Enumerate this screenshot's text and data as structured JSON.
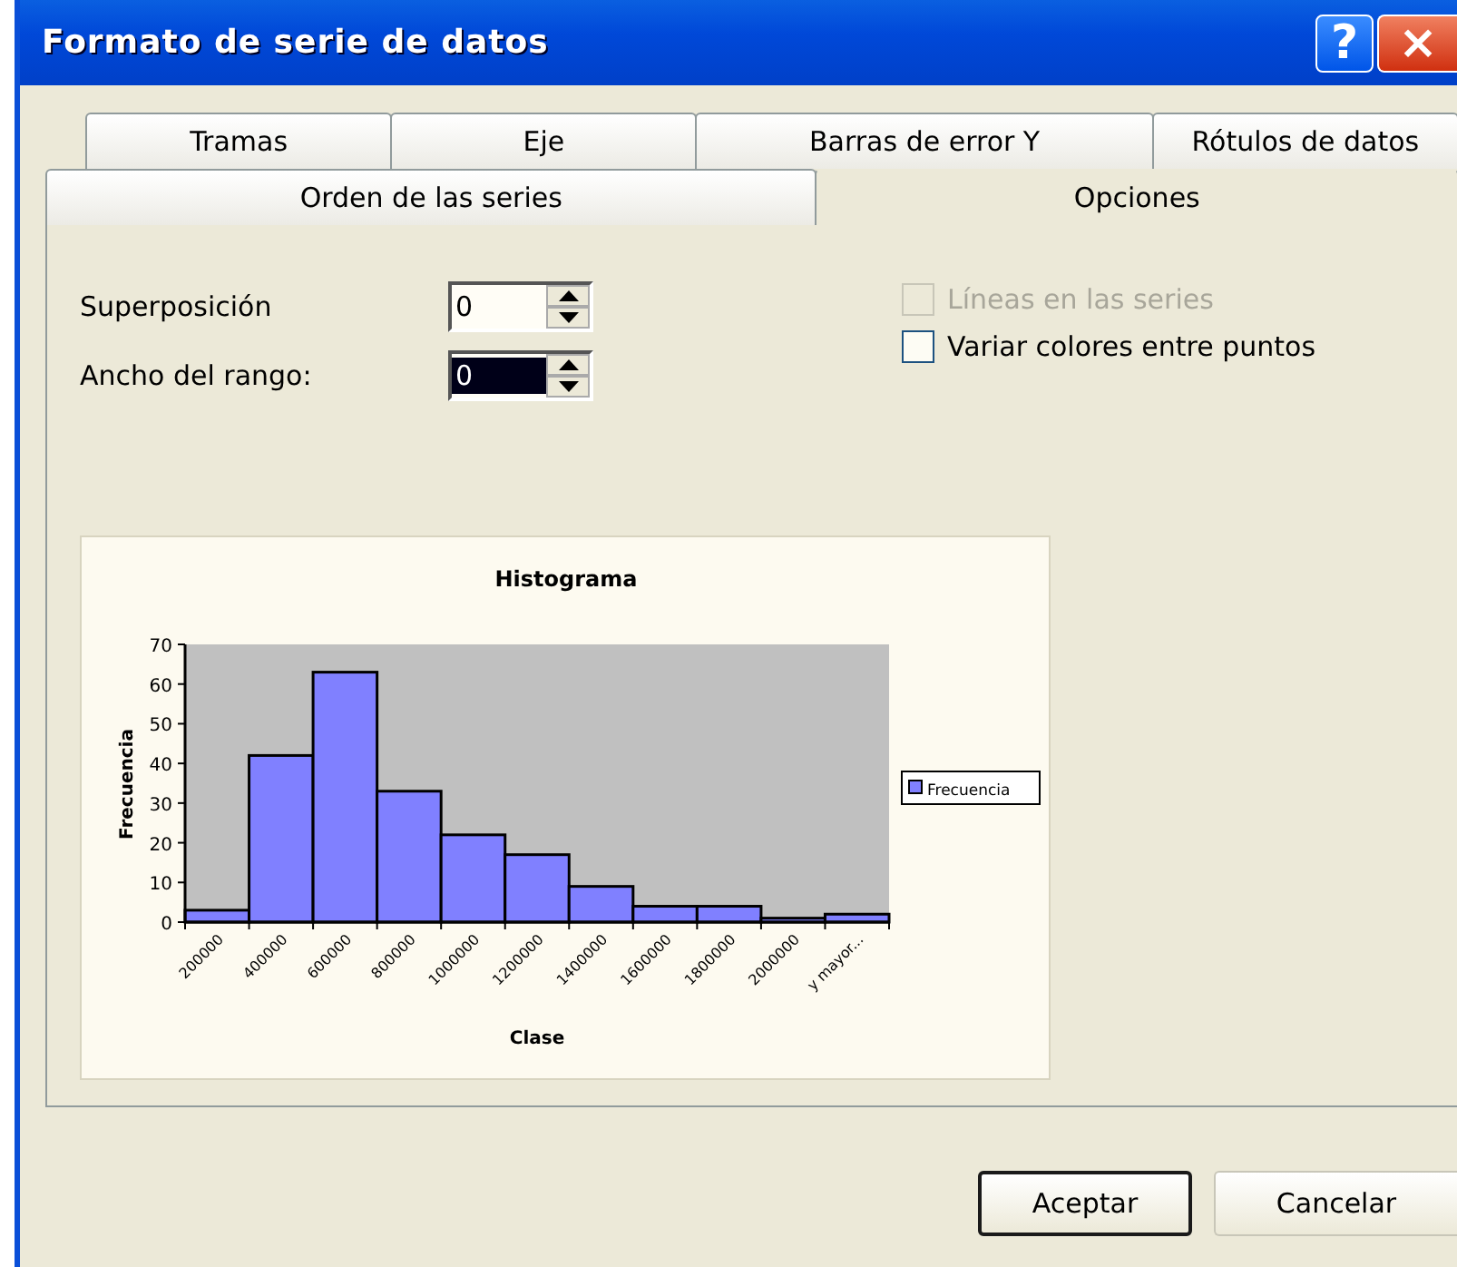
{
  "window": {
    "title": "Formato de serie de datos",
    "buttons": [
      {
        "kind": "help",
        "label": "?"
      },
      {
        "kind": "close",
        "label": "×"
      }
    ]
  },
  "tab_rows": [
    [
      {
        "label": "Tramas",
        "selected": false
      },
      {
        "label": "Eje",
        "selected": false
      },
      {
        "label": "Barras de error Y",
        "selected": false
      },
      {
        "label": "Rótulos de datos",
        "selected": false
      }
    ],
    [
      {
        "label": "Orden de las series",
        "selected": false
      },
      {
        "label": "Opciones",
        "selected": true
      }
    ]
  ],
  "spin_fields": [
    {
      "label": "Superposición",
      "value": "0",
      "selected": false
    },
    {
      "label": "Ancho del rango:",
      "value": "0",
      "selected": true
    }
  ],
  "checkboxes": [
    {
      "label": "Líneas en las series",
      "checked": false,
      "disabled": true
    },
    {
      "label": "Variar colores entre puntos",
      "checked": false,
      "disabled": false
    }
  ],
  "preview": {
    "chart_data": {
      "type": "bar",
      "title": "Histograma",
      "xlabel": "Clase",
      "ylabel": "Frecuencia",
      "categories": [
        "200000",
        "400000",
        "600000",
        "800000",
        "1000000",
        "1200000",
        "1400000",
        "1600000",
        "1800000",
        "2000000",
        "y mayor..."
      ],
      "series": [
        {
          "name": "Frecuencia",
          "color": "#8080ff",
          "values": [
            3,
            42,
            63,
            33,
            22,
            17,
            9,
            4,
            4,
            1,
            2
          ]
        }
      ],
      "ylim": [
        0,
        70
      ],
      "yticks": [
        0,
        10,
        20,
        30,
        40,
        50,
        60,
        70
      ]
    }
  },
  "buttons": [
    {
      "label": "Aceptar",
      "default": true
    },
    {
      "label": "Cancelar",
      "default": false
    }
  ]
}
